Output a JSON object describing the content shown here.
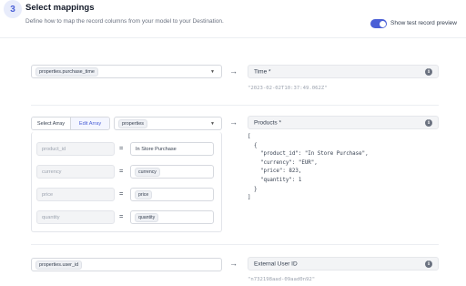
{
  "header": {
    "step_number": "3",
    "title": "Select mappings",
    "description": "Define how to map the record columns from your model to your Destination.",
    "toggle_label": "Show test record preview",
    "toggle_on": true
  },
  "mapping1": {
    "source": "properties.purchase_time",
    "destination": "Time *",
    "example": "\"2023-02-02T10:37:49.062Z\""
  },
  "mapping2": {
    "tabs": [
      "Select Array",
      "Edit Array"
    ],
    "active_tab": "Edit Array",
    "source": "properties",
    "destination": "Products *",
    "rows": [
      {
        "field": "product_id",
        "value": "In Store Purchase",
        "value_is_pill": false
      },
      {
        "field": "currency",
        "value": "currency",
        "value_is_pill": true
      },
      {
        "field": "price",
        "value": "price",
        "value_is_pill": true
      },
      {
        "field": "quantity",
        "value": "quantity",
        "value_is_pill": true
      }
    ],
    "json_preview": "[\n  {\n    \"product_id\": \"In Store Purchase\",\n    \"currency\": \"EUR\",\n    \"price\": 823,\n    \"quantity\": 1\n  }\n]"
  },
  "mapping3": {
    "source": "properties.user_id",
    "destination": "External User ID",
    "example": "\"n732198aad-09aad0n92\""
  },
  "colors": {
    "accent": "#4a5fd6",
    "field_border": "#d6d9df",
    "dest_bg": "#f3f4f6"
  },
  "icons": {
    "arrow": "right-arrow-icon",
    "info": "info-icon",
    "caret": "chevron-down-icon"
  }
}
